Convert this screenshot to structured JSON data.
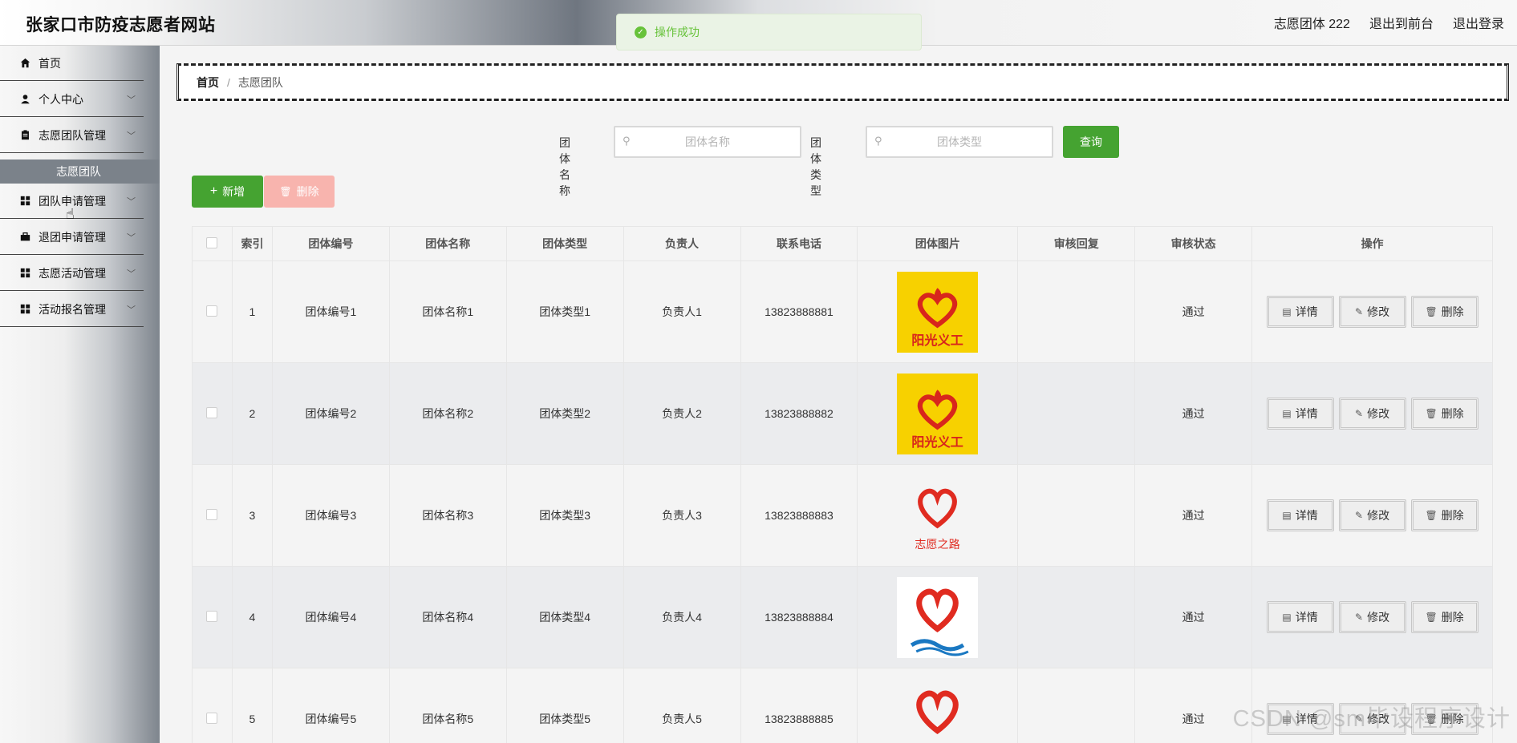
{
  "header": {
    "title": "张家口市防疫志愿者网站",
    "user": "志愿团体 222",
    "to_front": "退出到前台",
    "logout": "退出登录"
  },
  "toast": {
    "message": "操作成功"
  },
  "sidebar": {
    "items": [
      {
        "label": "首页",
        "icon": "home-icon"
      },
      {
        "label": "个人中心",
        "icon": "user-icon"
      },
      {
        "label": "志愿团队管理",
        "icon": "clipboard-icon"
      },
      {
        "label": "团队申请管理",
        "icon": "grid-icon"
      },
      {
        "label": "退团申请管理",
        "icon": "briefcase-icon"
      },
      {
        "label": "志愿活动管理",
        "icon": "grid-icon"
      },
      {
        "label": "活动报名管理",
        "icon": "grid-icon"
      }
    ],
    "active_sub": "志愿团队"
  },
  "breadcrumb": {
    "home": "首页",
    "sep": "/",
    "current": "志愿团队"
  },
  "search": {
    "name_label": "团体名称",
    "name_placeholder": "团体名称",
    "type_label": "团体类型",
    "type_placeholder": "团体类型",
    "query_label": "查询"
  },
  "actions": {
    "add": "新增",
    "delete": "删除"
  },
  "table": {
    "headers": [
      "索引",
      "团体编号",
      "团体名称",
      "团体类型",
      "负责人",
      "联系电话",
      "团体图片",
      "审核回复",
      "审核状态",
      "操作"
    ],
    "rows": [
      {
        "idx": "1",
        "code": "团体编号1",
        "name": "团体名称1",
        "type": "团体类型1",
        "leader": "负责人1",
        "phone": "13823888881",
        "reply": "",
        "status": "通过",
        "img": "阳光义工"
      },
      {
        "idx": "2",
        "code": "团体编号2",
        "name": "团体名称2",
        "type": "团体类型2",
        "leader": "负责人2",
        "phone": "13823888882",
        "reply": "",
        "status": "通过",
        "img": "阳光义工"
      },
      {
        "idx": "3",
        "code": "团体编号3",
        "name": "团体名称3",
        "type": "团体类型3",
        "leader": "负责人3",
        "phone": "13823888883",
        "reply": "",
        "status": "通过",
        "img": "志愿之路"
      },
      {
        "idx": "4",
        "code": "团体编号4",
        "name": "团体名称4",
        "type": "团体类型4",
        "leader": "负责人4",
        "phone": "13823888884",
        "reply": "",
        "status": "通过",
        "img": ""
      },
      {
        "idx": "5",
        "code": "团体编号5",
        "name": "团体名称5",
        "type": "团体类型5",
        "leader": "负责人5",
        "phone": "13823888885",
        "reply": "",
        "status": "通过",
        "img": ""
      }
    ],
    "ops": {
      "detail": "详情",
      "edit": "修改",
      "delete": "删除"
    }
  },
  "watermark": "CSDN @sm毕设程序设计",
  "colors": {
    "primary": "#45a331",
    "danger_light": "#f8b4ae",
    "toast_text": "#67c23a"
  }
}
